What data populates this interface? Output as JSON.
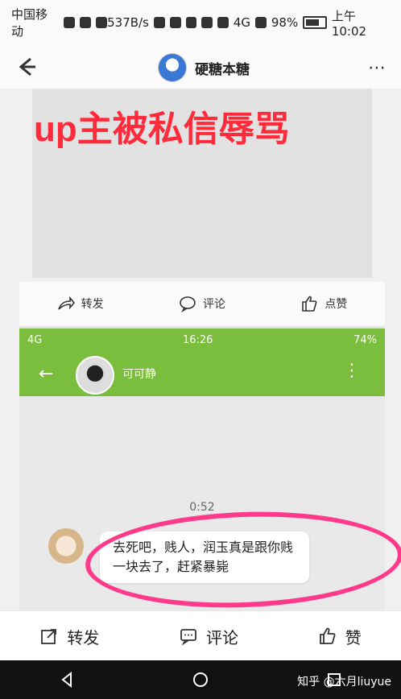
{
  "status_bar": {
    "carrier": "中国移动",
    "speed": "537B/s",
    "network": "4G",
    "battery": "98%",
    "time": "上午10:02"
  },
  "app_bar": {
    "title": "硬糖本糖"
  },
  "post": {
    "headline": "up主被私信辱骂",
    "actions": {
      "share": "转发",
      "comment": "评论",
      "like": "点赞"
    }
  },
  "wechat": {
    "status": {
      "network": "4G",
      "time": "16:26",
      "battery": "74%"
    },
    "contact_name": "可可静",
    "message_time": "0:52",
    "message": "去死吧，贱人，润玉真是跟你贱一块去了，赶紧暴毙"
  },
  "bottom_actions": {
    "share": "转发",
    "comment": "评论",
    "like": "赞"
  },
  "watermark": "知乎 @六月liuyue",
  "colors": {
    "headline": "#ff2b3b",
    "wechat_green": "#7bbd3c",
    "highlight": "#ff3a8b"
  }
}
